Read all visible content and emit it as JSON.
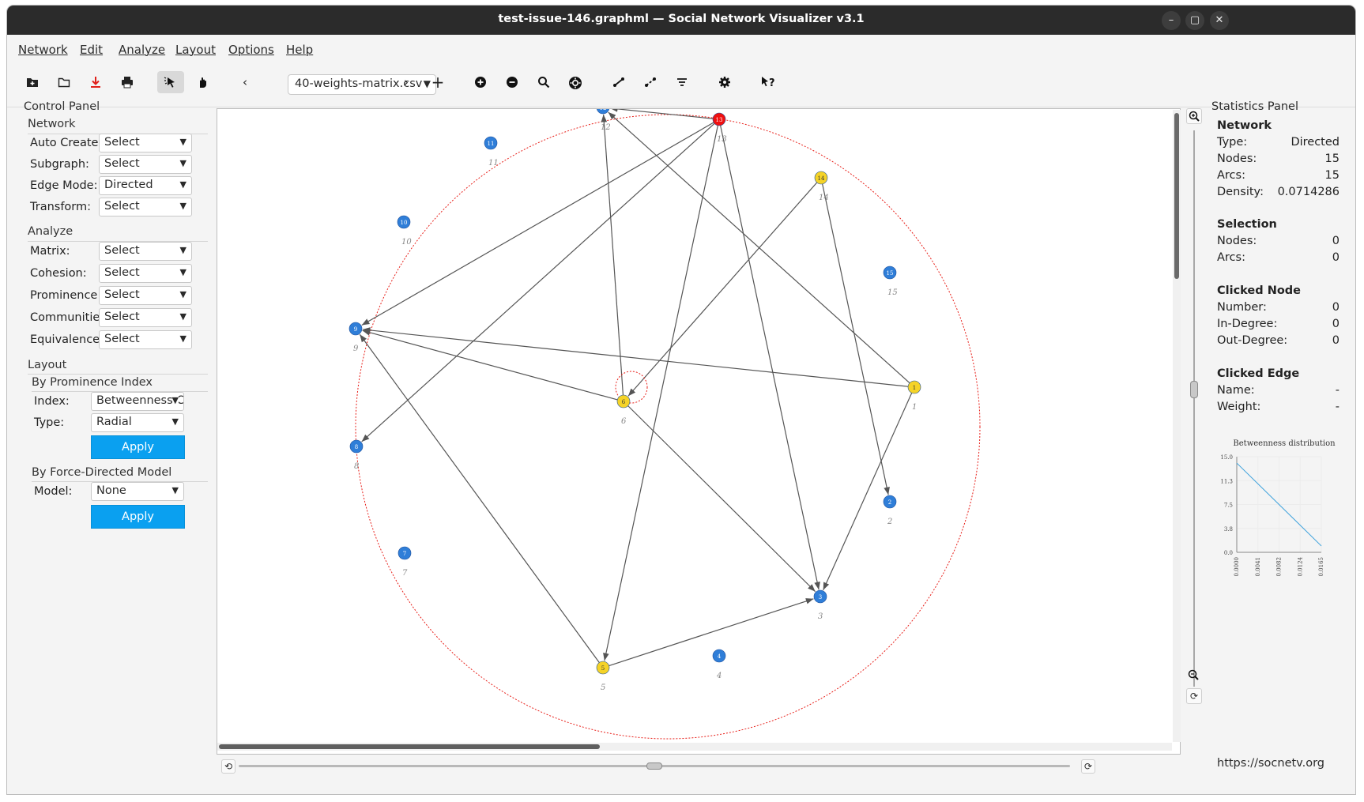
{
  "window": {
    "title": "test-issue-146.graphml — Social Network Visualizer v3.1",
    "minimize": "–",
    "maximize": "▢",
    "close": "✕"
  },
  "menubar": [
    "Network",
    "Edit",
    "Analyze",
    "Layout",
    "Options",
    "Help"
  ],
  "toolbar": {
    "file_combo": "40-weights-matrix.csv",
    "prev": "‹",
    "next": "›",
    "add": "+"
  },
  "control_panel": {
    "title": "Control Panel",
    "network": {
      "title": "Network",
      "rows": [
        {
          "label": "Auto Create:",
          "value": "Select"
        },
        {
          "label": "Subgraph:",
          "value": "Select"
        },
        {
          "label": "Edge Mode:",
          "value": "Directed"
        },
        {
          "label": "Transform:",
          "value": "Select"
        }
      ]
    },
    "analyze": {
      "title": "Analyze",
      "rows": [
        {
          "label": "Matrix:",
          "value": "Select"
        },
        {
          "label": "Cohesion:",
          "value": "Select"
        },
        {
          "label": "Prominence:",
          "value": "Select"
        },
        {
          "label": "Communities",
          "value": "Select"
        },
        {
          "label": "Equivalence:",
          "value": "Select"
        }
      ]
    },
    "layout": {
      "title": "Layout",
      "prominence": {
        "title": "By Prominence Index",
        "index_label": "Index:",
        "index_value": "Betweenness C",
        "type_label": "Type:",
        "type_value": "Radial",
        "apply": "Apply"
      },
      "force": {
        "title": "By Force-Directed Model",
        "model_label": "Model:",
        "model_value": "None",
        "apply": "Apply"
      }
    }
  },
  "graph": {
    "colors": {
      "blue": "#2f7ed8",
      "yellow": "#f5d327",
      "red": "#f01010",
      "edge": "#555555",
      "circle": "#e8201a"
    },
    "nodes": [
      {
        "id": "1",
        "color": "yellow"
      },
      {
        "id": "2",
        "color": "blue"
      },
      {
        "id": "3",
        "color": "blue"
      },
      {
        "id": "4",
        "color": "blue"
      },
      {
        "id": "5",
        "color": "yellow"
      },
      {
        "id": "6",
        "color": "yellow"
      },
      {
        "id": "7",
        "color": "blue"
      },
      {
        "id": "8",
        "color": "blue"
      },
      {
        "id": "9",
        "color": "blue"
      },
      {
        "id": "10",
        "color": "blue"
      },
      {
        "id": "11",
        "color": "blue"
      },
      {
        "id": "12",
        "color": "blue"
      },
      {
        "id": "13",
        "color": "red"
      },
      {
        "id": "14",
        "color": "yellow"
      },
      {
        "id": "15",
        "color": "blue"
      }
    ],
    "edges": [
      [
        "13",
        "12"
      ],
      [
        "13",
        "9"
      ],
      [
        "13",
        "8"
      ],
      [
        "13",
        "5"
      ],
      [
        "13",
        "3"
      ],
      [
        "14",
        "6"
      ],
      [
        "14",
        "2"
      ],
      [
        "1",
        "12"
      ],
      [
        "1",
        "9"
      ],
      [
        "1",
        "3"
      ],
      [
        "6",
        "12"
      ],
      [
        "6",
        "9"
      ],
      [
        "6",
        "3"
      ],
      [
        "5",
        "9"
      ],
      [
        "5",
        "3"
      ],
      [
        "6",
        "6"
      ]
    ]
  },
  "statistics": {
    "title": "Statistics Panel",
    "network": {
      "title": "Network",
      "rows": [
        {
          "label": "Type:",
          "value": "Directed"
        },
        {
          "label": "Nodes:",
          "value": "15"
        },
        {
          "label": "Arcs:",
          "value": "15"
        },
        {
          "label": "Density:",
          "value": "0.0714286"
        }
      ]
    },
    "selection": {
      "title": "Selection",
      "rows": [
        {
          "label": "Nodes:",
          "value": "0"
        },
        {
          "label": "Arcs:",
          "value": "0"
        }
      ]
    },
    "clicked_node": {
      "title": "Clicked Node",
      "rows": [
        {
          "label": "Number:",
          "value": "0"
        },
        {
          "label": "In-Degree:",
          "value": "0"
        },
        {
          "label": "Out-Degree:",
          "value": "0"
        }
      ]
    },
    "clicked_edge": {
      "title": "Clicked Edge",
      "rows": [
        {
          "label": "Name:",
          "value": "-"
        },
        {
          "label": "Weight:",
          "value": "-"
        }
      ]
    },
    "url": "https://socnetv.org"
  },
  "chart_data": {
    "type": "line",
    "title": "Betweenness distribution",
    "xlabel": "",
    "ylabel": "",
    "x": [
      0.0,
      0.0166
    ],
    "series": [
      {
        "values": [
          14.0,
          1.0
        ]
      }
    ],
    "xticks": [
      "0.0000",
      "0.0041",
      "0.0082",
      "0.0124",
      "0.0165"
    ],
    "yticks": [
      "15.0",
      "11.3",
      "7.5",
      "3.8",
      "0.0"
    ],
    "xlim": [
      0,
      0.0166
    ],
    "ylim": [
      0,
      15
    ],
    "color": "#3aa0dc",
    "grid": true
  }
}
